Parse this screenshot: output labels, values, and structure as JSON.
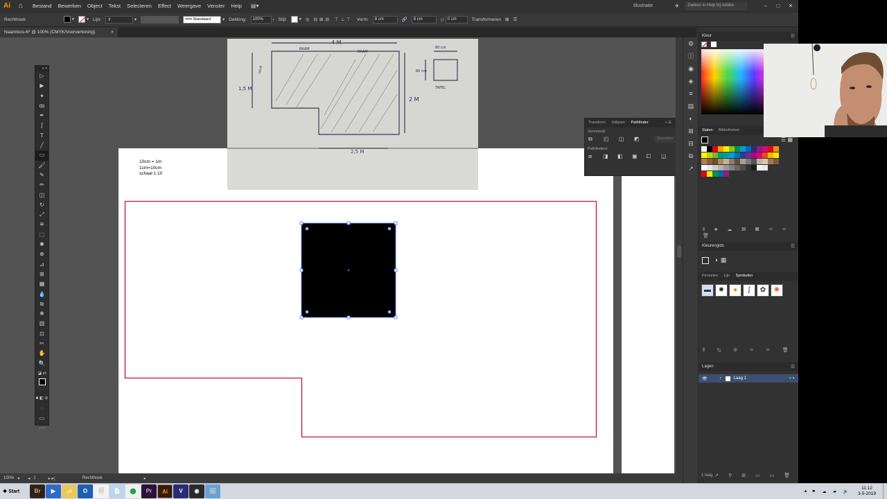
{
  "menubar": {
    "logo": "Ai",
    "items": [
      "Bestand",
      "Bewerken",
      "Object",
      "Tekst",
      "Selecteren",
      "Effect",
      "Weergave",
      "Venster",
      "Help"
    ],
    "workspace": "Illustratie",
    "search_placeholder": "Zoeken in Help bij Adobe"
  },
  "controlbar": {
    "tool_name": "Rechthoek",
    "stroke_label": "Lijn:",
    "stroke_style": "Standaard",
    "opacity_label": "Dekking:",
    "opacity_value": "100%",
    "style_label": "Stijl:",
    "shape_label": "Vorm:",
    "width_value": "8 cm",
    "height_value": "8 cm",
    "angle_value": "0 cm",
    "transform_label": "Transformeren"
  },
  "document": {
    "tab_title": "Naamloos-6* @ 100% (CMYK/Voorvertoning)",
    "tab_close": "×",
    "scale_note": [
      "10cm = 1m",
      "1cm=10cm",
      "schaal 1:10"
    ]
  },
  "sketch": {
    "top_dim": "4 M",
    "raam1": "RAAM",
    "raam2": "RAAM",
    "left_dim": "1,5 M",
    "right_dim": "2 M",
    "bottom_dim": "2,5 M",
    "table_dim_top": "80 cm",
    "table_dim_left": "80 cm",
    "table_label": "TAFEL",
    "door_label": "DEUR"
  },
  "statusbar": {
    "zoom": "100%",
    "artboard_no": "1",
    "tool": "Rechthoek"
  },
  "pathfinder": {
    "tabs": [
      "Transform",
      "Uitlijnen",
      "Pathfinder"
    ],
    "active_tab": "Pathfinder",
    "shape_modes_label": "Vormmodi:",
    "pathfinders_label": "Pathfinders:",
    "expand_label": "Uitvouwen"
  },
  "panels": {
    "kleur_title": "Kleur",
    "swatch_tabs": [
      "Stalen",
      "Bibliotheken"
    ],
    "kleurengids_title": "Kleurengids",
    "symbol_tabs": [
      "Penselen",
      "Lijn",
      "Symbolen"
    ],
    "layers_title": "Lagen",
    "layer_name": "Laag 1",
    "layer_count": "1 laag"
  },
  "taskbar": {
    "start_label": "Start",
    "apps": [
      "Br",
      "▶",
      "📁",
      "O",
      "🗐",
      "📄",
      "⬤",
      "Pr",
      "Ai",
      "V",
      "◉",
      "🖼"
    ],
    "time": "11:12",
    "date": "3-5-2019"
  },
  "colors": {
    "accent_red": "#c8102e",
    "selection_blue": "#4a7aff",
    "app_bg": "#323232",
    "canvas_bg": "#535353"
  },
  "swatches": [
    [
      "#ffffff",
      "#000000",
      "#e2001a",
      "#f7a600",
      "#ffed00",
      "#97bf0d",
      "#00963f",
      "#009bdb",
      "#0069b4",
      "#312783",
      "#951b81",
      "#e6007e",
      "#e30613",
      "#f29100"
    ],
    [
      "#fff500",
      "#c5d300",
      "#7ab929",
      "#009b77",
      "#00a19a",
      "#00a0df",
      "#0070ba",
      "#2a3a8c",
      "#6a2c91",
      "#b5007e",
      "#e5007d",
      "#e84e0f",
      "#fbb800",
      "#ffe300"
    ],
    [
      "#b17f4a",
      "#8b5e3c",
      "#6e4a2f",
      "#a68a64",
      "#c9b18c",
      "#8d7b6a",
      "#5e4e3e",
      "#a1a1a1",
      "#7a7a7a",
      "#545454",
      "#bfb5a1",
      "#d1c7b3",
      "#9e7752",
      "#7a5b3e"
    ],
    [
      "#ffffff",
      "#e6e6e6",
      "#cccccc",
      "#b3b3b3",
      "#999999",
      "#808080",
      "#666666",
      "#4d4d4d",
      "#333333",
      "#1a1a1a",
      "#f5f5f5",
      "#ebebeb"
    ],
    [
      "#e2001a",
      "#ffed00",
      "#00963f",
      "#0069b4",
      "#951b81"
    ]
  ]
}
